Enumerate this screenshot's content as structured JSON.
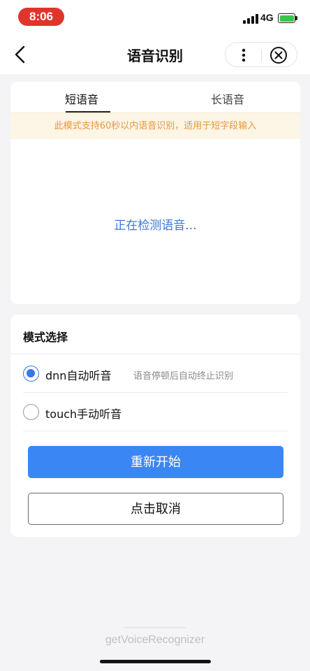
{
  "status_bar": {
    "time": "8:06",
    "network": "4G",
    "signal_icon": "signal-bars-icon",
    "battery_icon": "battery-charging-icon",
    "colors": {
      "time_pill": "#e0352d",
      "battery": "#3cc44a"
    }
  },
  "nav": {
    "title": "语音识别",
    "back_icon": "chevron-left-icon",
    "more_icon": "more-vertical-icon",
    "close_icon": "close-circle-icon"
  },
  "recognizer": {
    "tabs": [
      {
        "label": "短语音",
        "selected": true
      },
      {
        "label": "长语音",
        "selected": false
      }
    ],
    "tip": "此模式支持60秒以内语音识别，适用于短字段输入",
    "status": "正在检测语音..."
  },
  "mode_select": {
    "title": "模式选择",
    "options": [
      {
        "label": "dnn自动听音",
        "hint": "语音停顿后自动终止识别",
        "checked": true
      },
      {
        "label": "touch手动听音",
        "hint": "",
        "checked": false
      }
    ]
  },
  "buttons": {
    "restart": "重新开始",
    "cancel": "点击取消"
  },
  "footer": {
    "label": "getVoiceRecognizer"
  },
  "colors": {
    "accent": "#3a86f5",
    "status_text": "#3a78d8",
    "tip_text": "#e5983d",
    "tip_bg": "#fdf5e6"
  }
}
